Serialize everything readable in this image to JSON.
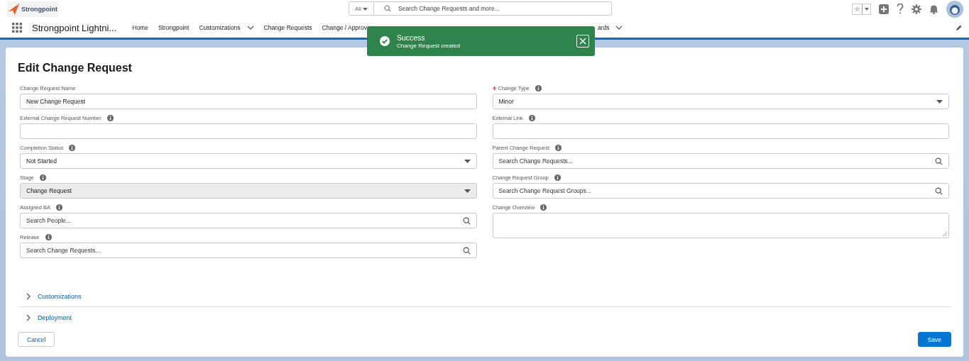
{
  "header": {
    "logo": "Strongpoint",
    "scope": "All",
    "search": {
      "placeholder": "Search Change Requests and more..."
    }
  },
  "nav": {
    "app_name": "Strongpoint Lightni...",
    "items": [
      {
        "label": "Home",
        "dropdown": false
      },
      {
        "label": "Strongpoint",
        "dropdown": false
      },
      {
        "label": "Customizations",
        "dropdown": true
      },
      {
        "label": "Change Requests",
        "dropdown": false
      },
      {
        "label": "Change / Approv",
        "dropdown": false
      }
    ],
    "items_after_toast": [
      {
        "label": "ards",
        "dropdown": true
      }
    ]
  },
  "toast": {
    "title": "Success",
    "message": "Change Request created"
  },
  "form": {
    "title": "Edit Change Request",
    "left": [
      {
        "label": "Change Request Name",
        "kind": "text",
        "value": "New Change Request",
        "info": false,
        "required": false,
        "disabled": false
      },
      {
        "label": "External Change Request Number",
        "kind": "text",
        "info": true,
        "required": false,
        "disabled": false
      },
      {
        "label": "Completion Status",
        "kind": "select",
        "value": "Not Started",
        "info": true,
        "required": false,
        "disabled": false
      },
      {
        "label": "Stage",
        "kind": "select",
        "value": "Change Request",
        "info": true,
        "required": false,
        "disabled": true
      },
      {
        "label": "Assigned BA",
        "kind": "lookup",
        "placeholder": "Search People...",
        "info": true,
        "required": false,
        "disabled": false
      },
      {
        "label": "Release",
        "kind": "lookup",
        "placeholder": "Search Change Requests...",
        "info": true,
        "required": false,
        "disabled": false
      }
    ],
    "right": [
      {
        "label": "Change Type",
        "kind": "select",
        "value": "Minor",
        "info": true,
        "required": true,
        "disabled": false
      },
      {
        "label": "External Link",
        "kind": "text",
        "info": true,
        "required": false,
        "disabled": false
      },
      {
        "label": "Parent Change Request",
        "kind": "lookup",
        "placeholder": "Search Change Requests...",
        "info": true,
        "required": false,
        "disabled": false
      },
      {
        "label": "Change Request Group",
        "kind": "lookup",
        "placeholder": "Search Change Request Groups...",
        "info": true,
        "required": false,
        "disabled": false
      },
      {
        "label": "Change Overview",
        "kind": "textarea",
        "info": true,
        "required": false,
        "disabled": false
      }
    ],
    "sections": [
      {
        "label": "Customizations",
        "expanded": false
      },
      {
        "label": "Deployment",
        "expanded": false
      }
    ],
    "buttons": [
      {
        "label": "Cancel",
        "kind": "neutral"
      },
      {
        "label": "Save",
        "kind": "brand"
      }
    ]
  }
}
